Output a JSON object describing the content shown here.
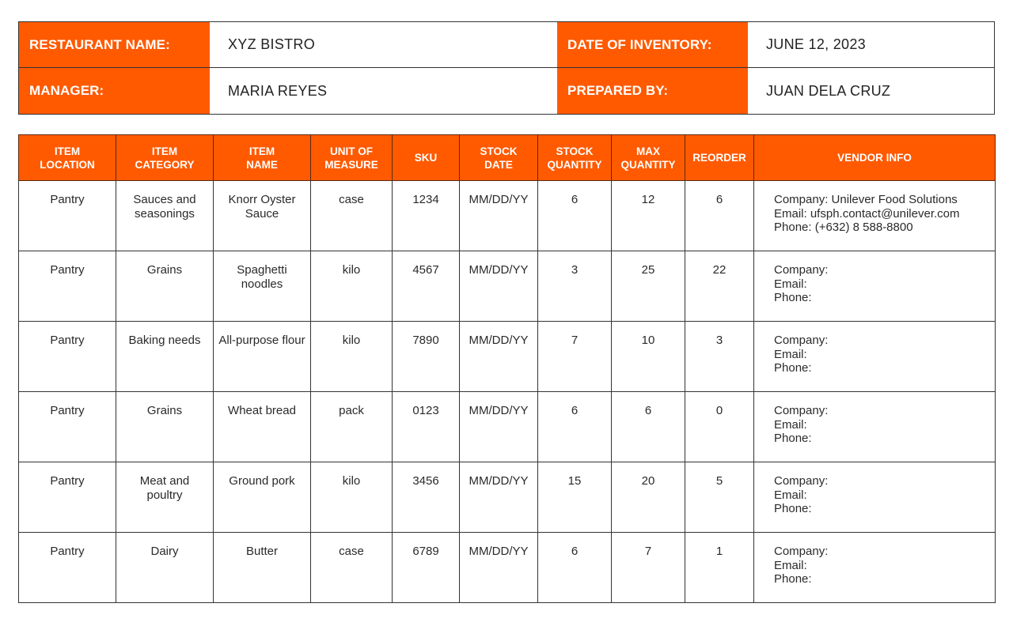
{
  "header": {
    "restaurant_name_label": "RESTAURANT NAME:",
    "restaurant_name": "XYZ BISTRO",
    "date_label": "DATE OF INVENTORY:",
    "date": "JUNE 12, 2023",
    "manager_label": "MANAGER:",
    "manager": "MARIA REYES",
    "prepared_by_label": "PREPARED BY:",
    "prepared_by": "JUAN DELA CRUZ"
  },
  "colors": {
    "accent": "#FF5A00",
    "border": "#333333",
    "text": "#222222"
  },
  "table": {
    "columns": [
      {
        "line1": "ITEM",
        "line2": "LOCATION"
      },
      {
        "line1": "ITEM",
        "line2": "CATEGORY"
      },
      {
        "line1": "ITEM",
        "line2": "NAME"
      },
      {
        "line1": "UNIT OF",
        "line2": "MEASURE"
      },
      {
        "line1": "SKU",
        "line2": ""
      },
      {
        "line1": "STOCK",
        "line2": "DATE"
      },
      {
        "line1": "STOCK",
        "line2": "QUANTITY"
      },
      {
        "line1": "MAX",
        "line2": "QUANTITY"
      },
      {
        "line1": "REORDER",
        "line2": ""
      },
      {
        "line1": "VENDOR INFO",
        "line2": ""
      }
    ],
    "rows": [
      {
        "location": "Pantry",
        "category": "Sauces and seasonings",
        "name": "Knorr Oyster Sauce",
        "unit": "case",
        "sku": "1234",
        "stock_date": "MM/DD/YY",
        "stock_qty": "6",
        "max_qty": "12",
        "reorder": "6",
        "vendor": {
          "company": "Company: Unilever Food Solutions",
          "email": "Email: ufsph.contact@unilever.com",
          "phone": "Phone: (+632) 8 588-8800"
        }
      },
      {
        "location": "Pantry",
        "category": "Grains",
        "name": "Spaghetti noodles",
        "unit": "kilo",
        "sku": "4567",
        "stock_date": "MM/DD/YY",
        "stock_qty": "3",
        "max_qty": "25",
        "reorder": "22",
        "vendor": {
          "company": "Company:",
          "email": "Email:",
          "phone": "Phone:"
        }
      },
      {
        "location": "Pantry",
        "category": "Baking needs",
        "name": "All-purpose flour",
        "unit": "kilo",
        "sku": "7890",
        "stock_date": "MM/DD/YY",
        "stock_qty": "7",
        "max_qty": "10",
        "reorder": "3",
        "vendor": {
          "company": "Company:",
          "email": "Email:",
          "phone": "Phone:"
        }
      },
      {
        "location": "Pantry",
        "category": "Grains",
        "name": "Wheat bread",
        "unit": "pack",
        "sku": "0123",
        "stock_date": "MM/DD/YY",
        "stock_qty": "6",
        "max_qty": "6",
        "reorder": "0",
        "vendor": {
          "company": "Company:",
          "email": "Email:",
          "phone": "Phone:"
        }
      },
      {
        "location": "Pantry",
        "category": "Meat and poultry",
        "name": "Ground pork",
        "unit": "kilo",
        "sku": "3456",
        "stock_date": "MM/DD/YY",
        "stock_qty": "15",
        "max_qty": "20",
        "reorder": "5",
        "vendor": {
          "company": "Company:",
          "email": "Email:",
          "phone": "Phone:"
        }
      },
      {
        "location": "Pantry",
        "category": "Dairy",
        "name": "Butter",
        "unit": "case",
        "sku": "6789",
        "stock_date": "MM/DD/YY",
        "stock_qty": "6",
        "max_qty": "7",
        "reorder": "1",
        "vendor": {
          "company": "Company:",
          "email": "Email:",
          "phone": "Phone:"
        }
      }
    ]
  }
}
